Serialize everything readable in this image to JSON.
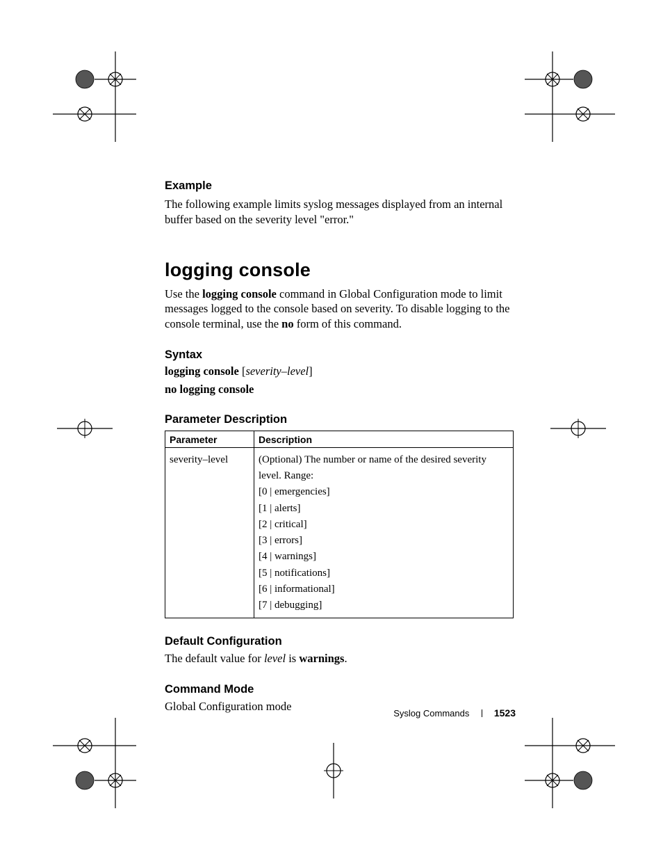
{
  "example": {
    "heading": "Example",
    "text": "The following example limits syslog messages displayed from an internal buffer based on the severity level \"error.\""
  },
  "section": {
    "title": "logging console",
    "intro_pre": "Use the ",
    "intro_cmd": "logging console",
    "intro_mid": " command in Global Configuration mode to limit messages logged to the console based on severity. To disable logging to the console terminal, use the ",
    "intro_no": "no",
    "intro_post": " form of this command."
  },
  "syntax": {
    "heading": "Syntax",
    "line1_cmd": "logging console",
    "line1_open": " [",
    "line1_param": "severity–level",
    "line1_close": "]",
    "line2": "no logging console"
  },
  "paramdesc": {
    "heading": "Parameter Description",
    "th_param": "Parameter",
    "th_desc": "Description",
    "row_param": "severity–level",
    "row_desc_a": "(Optional) The number or name of the desired severity level. Range:",
    "ranges": {
      "r0": "[0 | emergencies]",
      "r1": "[1 | alerts]",
      "r2": "[2 | critical]",
      "r3": "[3 | errors]",
      "r4": "[4 | warnings]",
      "r5": "[5 | notifications]",
      "r6": "[6 | informational]",
      "r7": "[7 | debugging]"
    }
  },
  "defconf": {
    "heading": "Default Configuration",
    "pre": "The default value for ",
    "ital": "level",
    "mid": " is ",
    "bold": "warnings",
    "post": "."
  },
  "cmdmode": {
    "heading": "Command Mode",
    "text": "Global Configuration mode"
  },
  "footer": {
    "chapter": "Syslog Commands",
    "page": "1523"
  }
}
